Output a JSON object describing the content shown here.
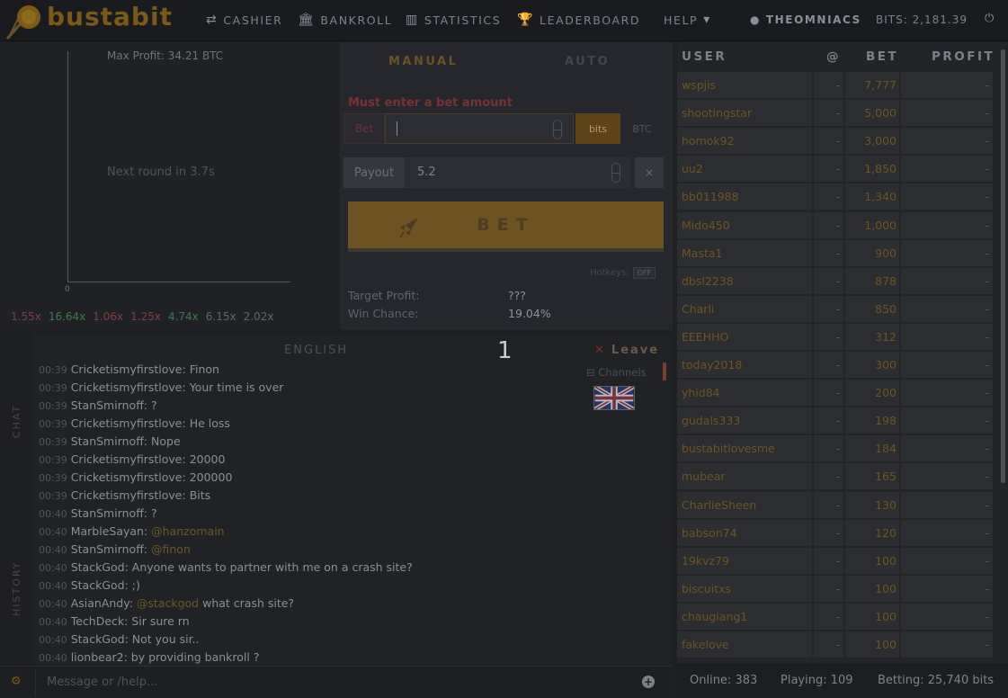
{
  "header": {
    "brand": "bustabit",
    "nav": [
      {
        "icon": "swap-arrows-icon",
        "glyph": "⇄",
        "label": "CASHIER"
      },
      {
        "icon": "bank-icon",
        "glyph": "🏛",
        "label": "BANKROLL"
      },
      {
        "icon": "bar-chart-icon",
        "glyph": "▥",
        "label": "STATISTICS"
      },
      {
        "icon": "trophy-icon",
        "glyph": "🏆",
        "label": "LEADERBOARD"
      },
      {
        "icon": "caret-down-icon",
        "glyph": "▾",
        "label": "HELP"
      }
    ],
    "username": "THEOMNIACS",
    "balance": "BITS: 2,181.39"
  },
  "chart": {
    "max_profit": "Max Profit: 34.21 BTC",
    "next_round": "Next round in 3.7s",
    "zero_label": "0",
    "history": [
      {
        "value": "1.55x",
        "color": "#d0595b"
      },
      {
        "value": "16.64x",
        "color": "#55c46f"
      },
      {
        "value": "1.06x",
        "color": "#d0595b"
      },
      {
        "value": "1.25x",
        "color": "#d0595b"
      },
      {
        "value": "4.74x",
        "color": "#55c46f"
      },
      {
        "value": "6.15x",
        "color": "#9aa0a8"
      },
      {
        "value": "2.02x",
        "color": "#9aa0a8"
      }
    ]
  },
  "controls": {
    "tab_manual": "MANUAL",
    "tab_auto": "AUTO",
    "error": "Must enter a bet amount",
    "bet_label": "Bet",
    "bet_value": "",
    "bits_label": "bits",
    "btc_label": "BTC",
    "payout_label": "Payout",
    "payout_value": "5.2",
    "clear_label": "×",
    "bet_button": "BET",
    "hotkeys_label": "Hotkeys:",
    "hotkeys_state": "OFF",
    "target_profit_label": "Target Profit:",
    "target_profit_value": "???",
    "win_chance_label": "Win Chance:",
    "win_chance_value": "19.04%"
  },
  "players": {
    "headers": {
      "user": "USER",
      "at": "@",
      "bet": "BET",
      "profit": "PROFIT"
    },
    "rows": [
      {
        "user": "wspjis",
        "at": "-",
        "bet": "7,777",
        "profit": "-"
      },
      {
        "user": "shootingstar",
        "at": "-",
        "bet": "5,000",
        "profit": "-"
      },
      {
        "user": "homok92",
        "at": "-",
        "bet": "3,000",
        "profit": "-"
      },
      {
        "user": "uu2",
        "at": "-",
        "bet": "1,850",
        "profit": "-"
      },
      {
        "user": "bb011988",
        "at": "-",
        "bet": "1,340",
        "profit": "-"
      },
      {
        "user": "Mido450",
        "at": "-",
        "bet": "1,000",
        "profit": "-"
      },
      {
        "user": "Masta1",
        "at": "-",
        "bet": "900",
        "profit": "-"
      },
      {
        "user": "dbsl2238",
        "at": "-",
        "bet": "878",
        "profit": "-"
      },
      {
        "user": "Charli",
        "at": "-",
        "bet": "850",
        "profit": "-"
      },
      {
        "user": "EEEHHO",
        "at": "-",
        "bet": "312",
        "profit": "-"
      },
      {
        "user": "today2018",
        "at": "-",
        "bet": "300",
        "profit": "-"
      },
      {
        "user": "yhid84",
        "at": "-",
        "bet": "200",
        "profit": "-"
      },
      {
        "user": "gudals333",
        "at": "-",
        "bet": "198",
        "profit": "-"
      },
      {
        "user": "bustabitlovesme",
        "at": "-",
        "bet": "184",
        "profit": "-"
      },
      {
        "user": "mubear",
        "at": "-",
        "bet": "165",
        "profit": "-"
      },
      {
        "user": "CharlieSheen",
        "at": "-",
        "bet": "130",
        "profit": "-"
      },
      {
        "user": "babson74",
        "at": "-",
        "bet": "120",
        "profit": "-"
      },
      {
        "user": "19kvz79",
        "at": "-",
        "bet": "100",
        "profit": "-"
      },
      {
        "user": "biscuitxs",
        "at": "-",
        "bet": "100",
        "profit": "-"
      },
      {
        "user": "chaugiang1",
        "at": "-",
        "bet": "100",
        "profit": "-"
      },
      {
        "user": "fakelove",
        "at": "-",
        "bet": "100",
        "profit": "-"
      }
    ],
    "footer": {
      "online": "Online: 383",
      "playing": "Playing: 109",
      "betting": "Betting: 25,740 bits"
    }
  },
  "chat": {
    "side_chat": "CHAT",
    "side_history": "HISTORY",
    "title": "ENGLISH",
    "leave": "Leave",
    "unread_count": "1",
    "channels": "Channels",
    "input_placeholder": "Message or /help...",
    "messages": [
      {
        "time": "00:39",
        "user": "Cricketismyfirstlove:",
        "text": " Finon",
        "mention": ""
      },
      {
        "time": "00:39",
        "user": "Cricketismyfirstlove:",
        "text": " Your time is over",
        "mention": ""
      },
      {
        "time": "00:39",
        "user": "StanSmirnoff:",
        "text": " ?",
        "mention": ""
      },
      {
        "time": "00:39",
        "user": "Cricketismyfirstlove:",
        "text": " He loss",
        "mention": ""
      },
      {
        "time": "00:39",
        "user": "StanSmirnoff:",
        "text": " Nope",
        "mention": ""
      },
      {
        "time": "00:39",
        "user": "Cricketismyfirstlove:",
        "text": " 20000",
        "mention": ""
      },
      {
        "time": "00:39",
        "user": "Cricketismyfirstlove:",
        "text": " 200000",
        "mention": ""
      },
      {
        "time": "00:39",
        "user": "Cricketismyfirstlove:",
        "text": " Bits",
        "mention": ""
      },
      {
        "time": "00:40",
        "user": "StanSmirnoff:",
        "text": " ?",
        "mention": ""
      },
      {
        "time": "00:40",
        "user": "MarbleSayan:",
        "text": "",
        "mention": " @hanzomain"
      },
      {
        "time": "00:40",
        "user": "StanSmirnoff:",
        "text": "",
        "mention": " @finon"
      },
      {
        "time": "00:40",
        "user": "StackGod:",
        "text": " Anyone wants to partner with me on a crash site?",
        "mention": ""
      },
      {
        "time": "00:40",
        "user": "StackGod:",
        "text": " ;)",
        "mention": ""
      },
      {
        "time": "00:40",
        "user": "AsianAndy:",
        "text": " what crash site?",
        "mention": " @stackgod"
      },
      {
        "time": "00:40",
        "user": "TechDeck:",
        "text": " Sir sure rn",
        "mention": ""
      },
      {
        "time": "00:40",
        "user": "StackGod:",
        "text": " Not you sir..",
        "mention": ""
      },
      {
        "time": "00:40",
        "user": "lionbear2:",
        "text": " by providing bankroll ?",
        "mention": ""
      }
    ]
  }
}
